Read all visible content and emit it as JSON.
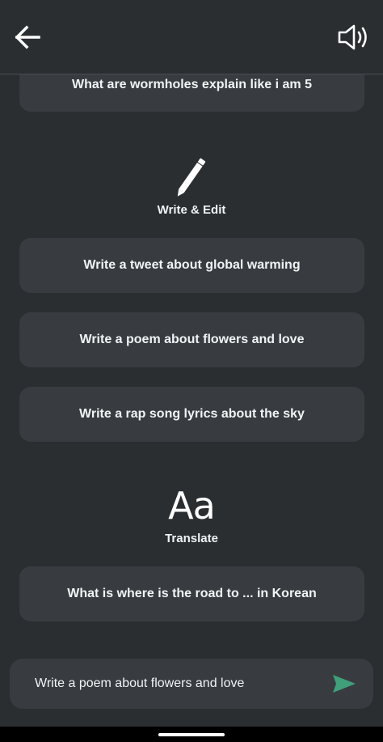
{
  "header": {
    "back_icon": "arrow-left-icon",
    "speaker_icon": "volume-icon"
  },
  "sections": {
    "explain": {
      "items": [
        "What are wormholes explain like i am 5"
      ]
    },
    "write_edit": {
      "icon": "pencil-icon",
      "label": "Write & Edit",
      "items": [
        "Write a tweet about global warming",
        "Write a poem about flowers and love",
        "Write a rap song lyrics about the sky"
      ]
    },
    "translate": {
      "icon_text": "Aa",
      "label": "Translate",
      "items": [
        "What is where is the road to ... in Korean"
      ]
    }
  },
  "input": {
    "value": "Write a poem about flowers and love",
    "send_icon": "send-icon",
    "send_color": "#3fa07a"
  },
  "colors": {
    "background": "#2a2e31",
    "card": "#383c40",
    "text": "#f1f3f4"
  }
}
